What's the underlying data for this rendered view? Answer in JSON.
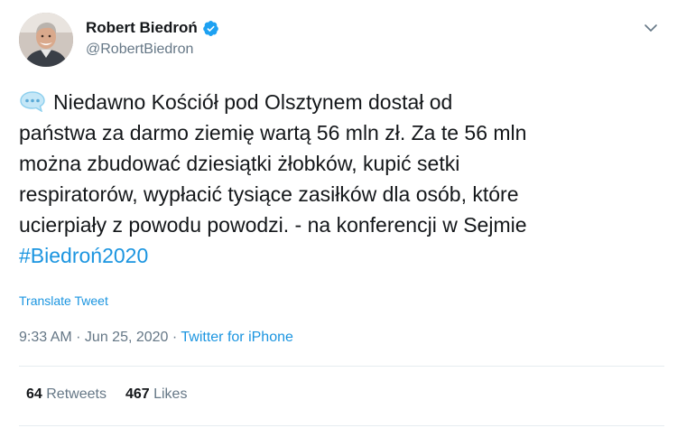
{
  "tweet": {
    "author": {
      "display_name": "Robert Biedroń",
      "handle": "@RobertBiedron",
      "verified": true,
      "verified_icon": "verified-badge-icon",
      "avatar_icon": "profile-photo"
    },
    "menu_icon": "chevron-down-icon",
    "body": {
      "emoji": "speech-balloon-icon",
      "text": "Niedawno Kościół pod Olsztynem dostał od\npaństwa za darmo ziemię wartą 56 mln zł. Za te 56 mln\nmożna zbudować dziesiątki żłobków, kupić setki\nrespiratorów, wypłacić tysiące zasiłków dla osób, które\nucierpiały z powodu powodzi. - na konferencji w Sejmie\n",
      "hashtag": "#Biedroń2020"
    },
    "translate_label": "Translate Tweet",
    "time": "9:33 AM",
    "separator": " · ",
    "date": "Jun 25, 2020",
    "source": "Twitter for iPhone",
    "stats": {
      "retweets_count": "64",
      "retweets_label": " Retweets",
      "likes_count": "467",
      "likes_label": " Likes"
    },
    "colors": {
      "text": "#14171a",
      "secondary": "#657786",
      "link": "#1b95e0",
      "divider": "#e6ecf0"
    }
  }
}
